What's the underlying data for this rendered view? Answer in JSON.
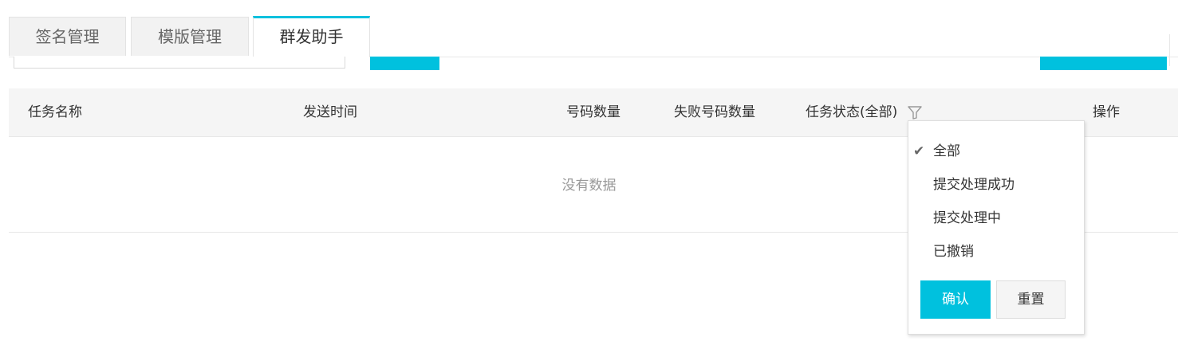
{
  "tabs": [
    {
      "label": "签名管理",
      "active": false
    },
    {
      "label": "模版管理",
      "active": false
    },
    {
      "label": "群发助手",
      "active": true
    }
  ],
  "table": {
    "columns": [
      "任务名称",
      "发送时间",
      "号码数量",
      "失败号码数量",
      "任务状态(全部)",
      "操作"
    ],
    "empty_text": "没有数据"
  },
  "filter_dropdown": {
    "options": [
      {
        "label": "全部",
        "checked": true
      },
      {
        "label": "提交处理成功",
        "checked": false
      },
      {
        "label": "提交处理中",
        "checked": false
      },
      {
        "label": "已撤销",
        "checked": false
      }
    ],
    "confirm_label": "确认",
    "reset_label": "重置"
  },
  "icons": {
    "filter": "filter-icon",
    "check": "check-icon"
  },
  "colors": {
    "accent": "#00c1de",
    "header_bg": "#f5f5f5",
    "muted_text": "#999999"
  }
}
